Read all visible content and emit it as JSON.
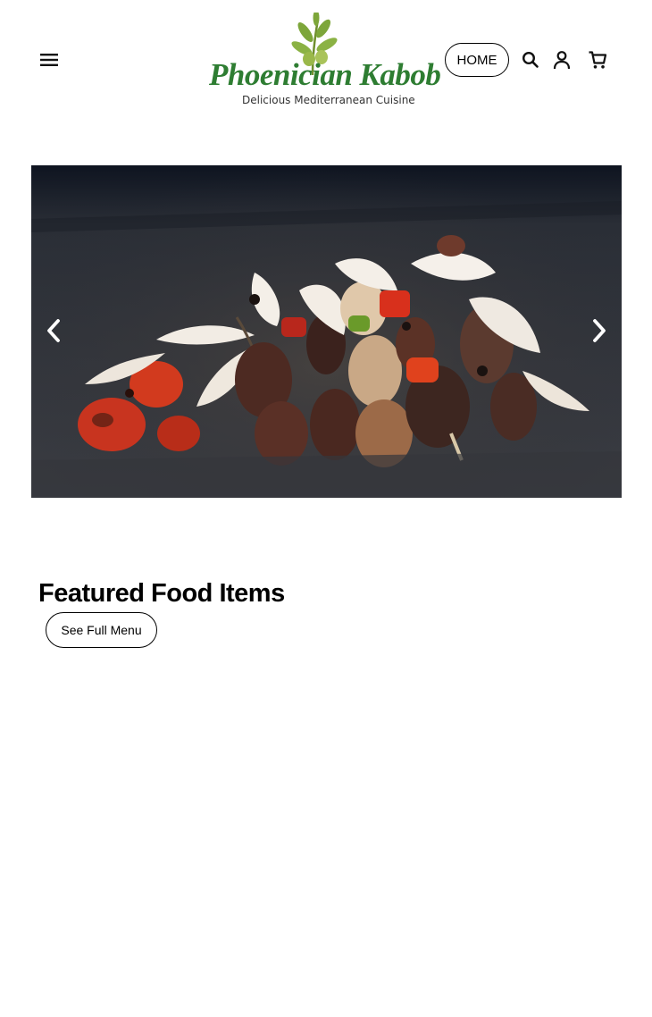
{
  "header": {
    "logo_name": "Phoenician Kabob",
    "logo_tagline": "Delicious Mediterranean Cuisine",
    "nav_home_label": "HOME",
    "icons": [
      "menu-icon",
      "search-icon",
      "user-icon",
      "cart-icon"
    ]
  },
  "carousel": {
    "prev_icon": "chevron-left-icon",
    "next_icon": "chevron-right-icon",
    "image_alt": ""
  },
  "featured": {
    "title": "Featured Food Items",
    "full_menu_label": "See Full Menu"
  },
  "colors": {
    "logo_green": "#2e7d32",
    "leaf_green": "#7da63a"
  }
}
